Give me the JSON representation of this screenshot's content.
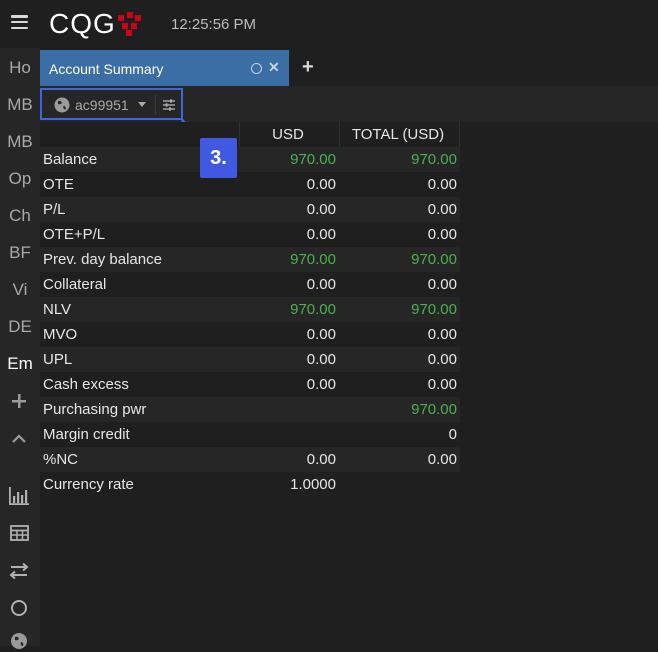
{
  "app": {
    "clock": "12:25:56 PM",
    "logo_text": "CQG"
  },
  "sidebar": {
    "items": [
      {
        "label": "Ho"
      },
      {
        "label": "MB"
      },
      {
        "label": "MB"
      },
      {
        "label": "Op"
      },
      {
        "label": "Ch"
      },
      {
        "label": "BF"
      },
      {
        "label": "Vi"
      },
      {
        "label": "DE"
      },
      {
        "label": "Em"
      }
    ],
    "icons": [
      "plus-icon",
      "chevron-up-icon",
      "bar-chart-icon",
      "table-icon",
      "transfer-icon",
      "circle-icon",
      "globe-icon"
    ]
  },
  "tab": {
    "label": "Account Summary"
  },
  "toolbar": {
    "account": "ac99951",
    "callout": "3."
  },
  "table": {
    "headers": [
      "",
      "USD",
      "TOTAL (USD)"
    ],
    "rows": [
      {
        "label": "Balance",
        "usd": "970.00",
        "total": "970.00",
        "green": true
      },
      {
        "label": "OTE",
        "usd": "0.00",
        "total": "0.00",
        "green": false
      },
      {
        "label": "P/L",
        "usd": "0.00",
        "total": "0.00",
        "green": false
      },
      {
        "label": "OTE+P/L",
        "usd": "0.00",
        "total": "0.00",
        "green": false
      },
      {
        "label": "Prev. day balance",
        "usd": "970.00",
        "total": "970.00",
        "green": true
      },
      {
        "label": "Collateral",
        "usd": "0.00",
        "total": "0.00",
        "green": false
      },
      {
        "label": "NLV",
        "usd": "970.00",
        "total": "970.00",
        "green": true
      },
      {
        "label": "MVO",
        "usd": "0.00",
        "total": "0.00",
        "green": false
      },
      {
        "label": "UPL",
        "usd": "0.00",
        "total": "0.00",
        "green": false
      },
      {
        "label": "Cash excess",
        "usd": "0.00",
        "total": "0.00",
        "green": false
      },
      {
        "label": "Purchasing pwr",
        "usd": "",
        "total": "970.00",
        "green": true
      },
      {
        "label": "Margin credit",
        "usd": "",
        "total": "0",
        "green": false
      },
      {
        "label": "%NC",
        "usd": "0.00",
        "total": "0.00",
        "green": false
      },
      {
        "label": "Currency rate",
        "usd": "1.0000",
        "total": "",
        "green": false
      }
    ]
  },
  "colors": {
    "accent": "#3a6ea5",
    "highlight": "#3f66d8",
    "positive": "#4caf50"
  }
}
